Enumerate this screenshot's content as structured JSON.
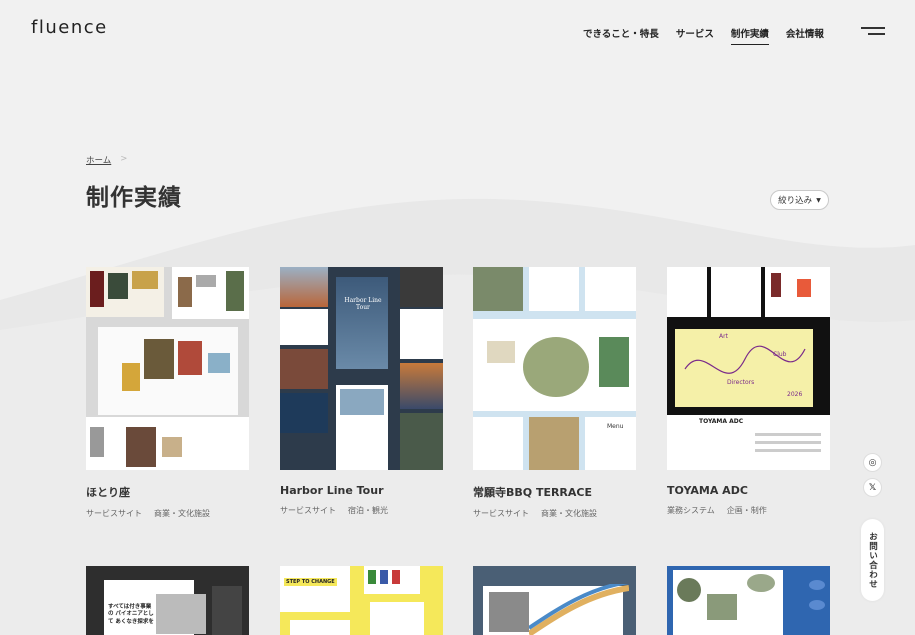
{
  "brand": {
    "logo": "fluence"
  },
  "nav": {
    "items": [
      {
        "label": "できること・特長",
        "active": false
      },
      {
        "label": "サービス",
        "active": false
      },
      {
        "label": "制作実績",
        "active": true
      },
      {
        "label": "会社情報",
        "active": false
      }
    ]
  },
  "breadcrumb": {
    "home": "ホーム",
    "separator": ">"
  },
  "page": {
    "title": "制作実績",
    "filter_label": "絞り込み"
  },
  "works": [
    {
      "title": "ほとり座",
      "tags": [
        "サービスサイト",
        "商業・文化施設"
      ]
    },
    {
      "title": "Harbor Line Tour",
      "tags": [
        "サービスサイト",
        "宿泊・観光"
      ]
    },
    {
      "title": "常願寺BBQ TERRACE",
      "tags": [
        "サービスサイト",
        "商業・文化施設"
      ]
    },
    {
      "title": "TOYAMA ADC",
      "tags": [
        "業務システム",
        "企画・制作"
      ]
    }
  ],
  "thumb_text": {
    "harbor_title": "Harbor Line Tour",
    "toyama_art": "Art",
    "toyama_club": "Club",
    "toyama_directors": "Directors",
    "toyama_year": "2026",
    "toyama_name": "TOYAMA ADC",
    "bbq_menu": "Menu",
    "row2_dark_copy": "すべては付き事業の パイオニアとして あくなき探求を",
    "row2_yellow_label": "STEP TO CHANGE"
  },
  "side": {
    "instagram_icon": "instagram-icon",
    "x_icon": "x-icon",
    "contact_label": "お問い合わせ"
  },
  "colors": {
    "background": "#f1f1f1",
    "text": "#333333",
    "harbor_navy": "#2d3b4b",
    "bbq_lightblue": "#cfe3f0",
    "toyama_yellow": "#f5f0a8",
    "row2_yellow": "#f5e85a",
    "row2_blue": "#2f66b0"
  }
}
